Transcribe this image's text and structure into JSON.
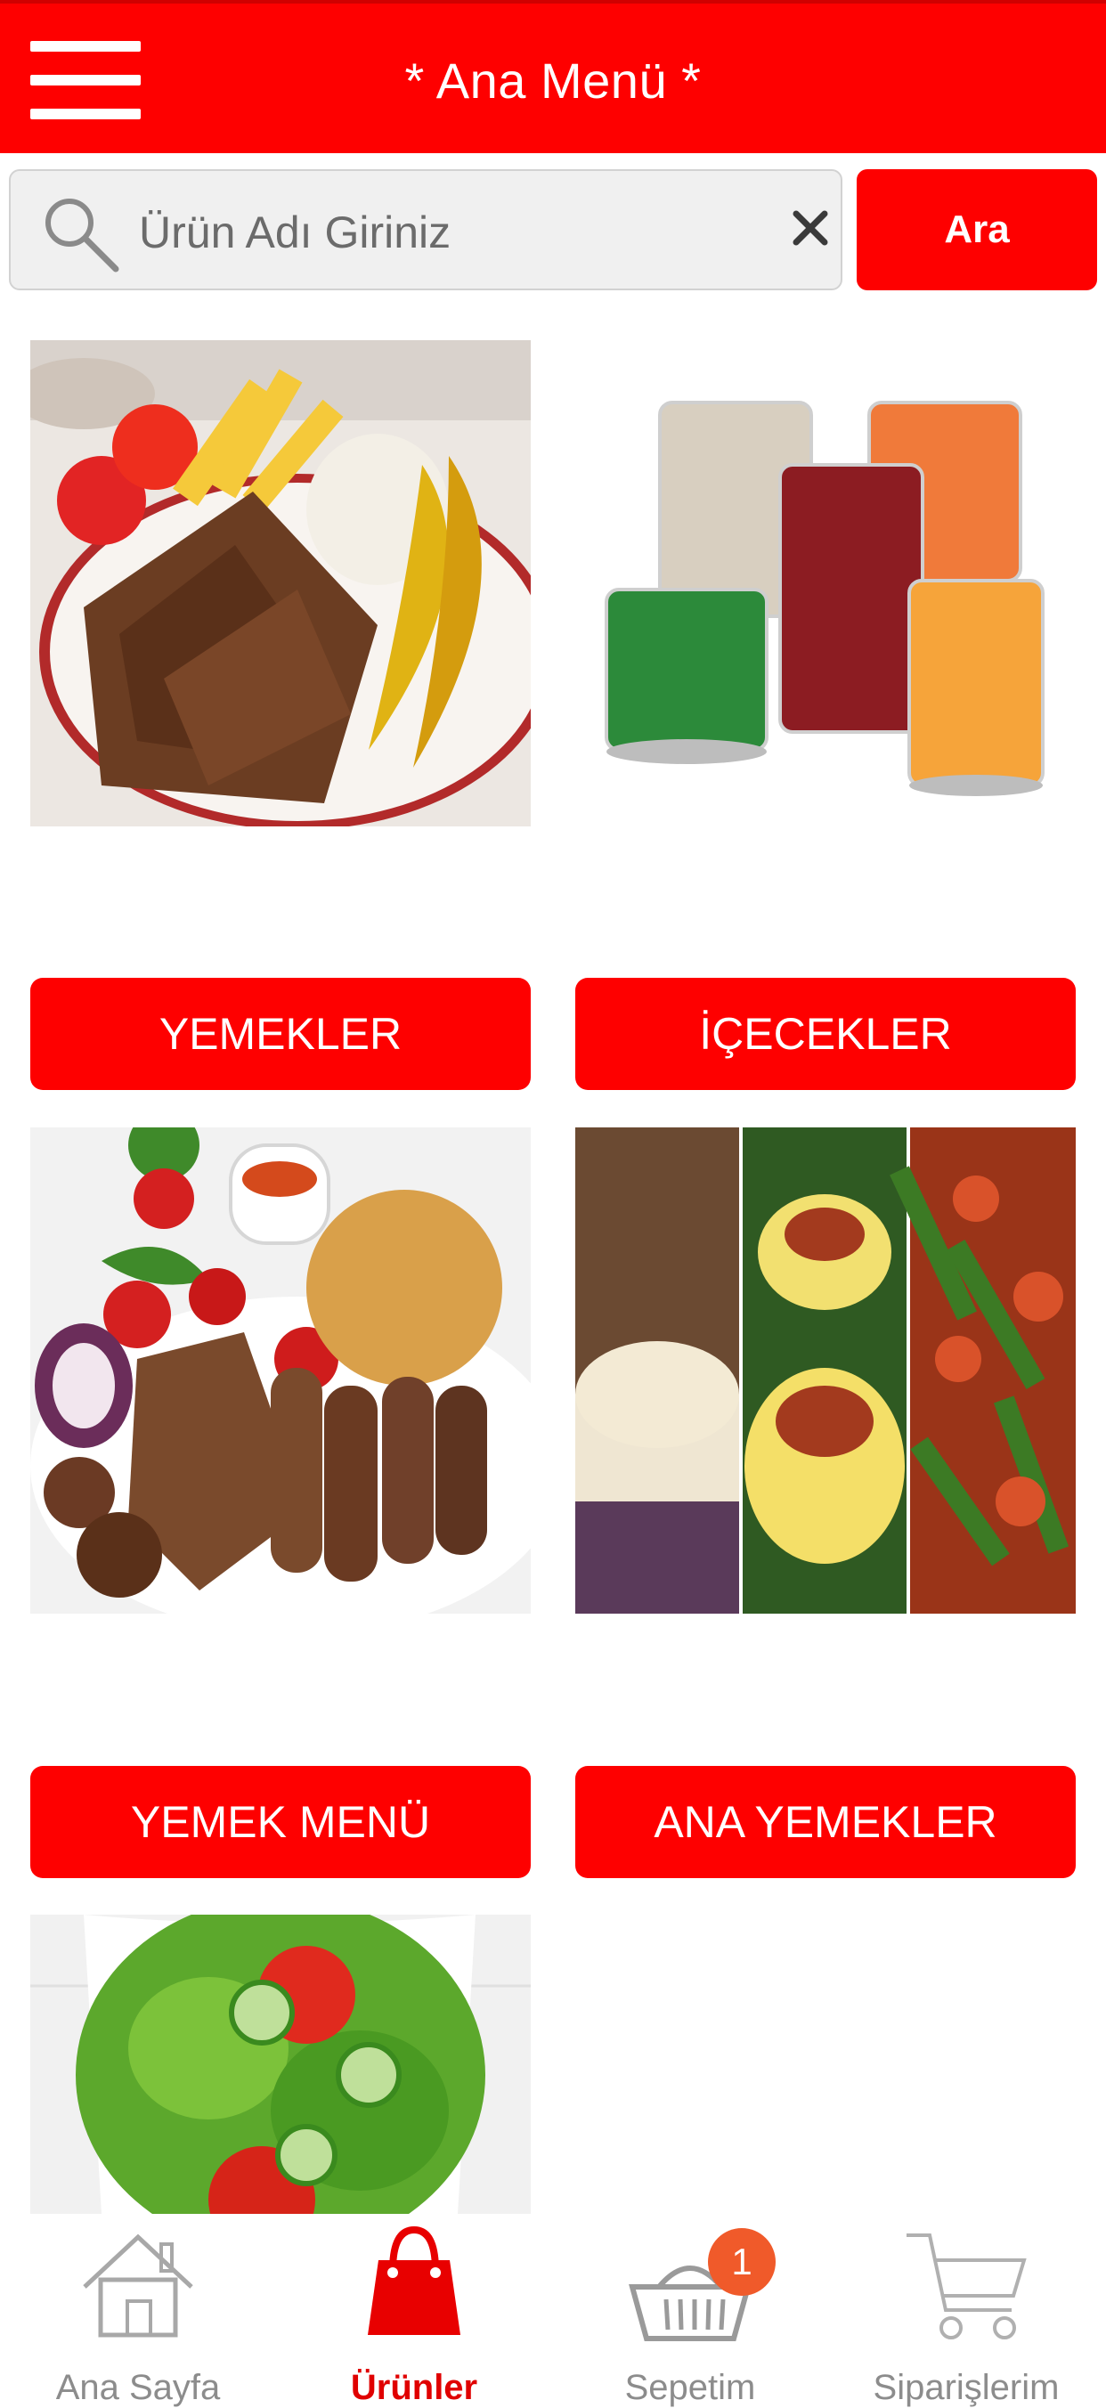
{
  "header": {
    "title": "* Ana Menü *",
    "menu_icon": "hamburger-menu-icon"
  },
  "search": {
    "placeholder": "Ürün Adı Giriniz",
    "value": "",
    "button_label": "Ara",
    "search_icon": "search-icon",
    "clear_icon": "close-icon"
  },
  "categories": [
    {
      "label": "YEMEKLER",
      "image": "doner-plate-image"
    },
    {
      "label": "İÇECEKLER",
      "image": "juice-glasses-image"
    },
    {
      "label": "YEMEK MENÜ",
      "image": "kebab-plate-image"
    },
    {
      "label": "ANA YEMEKLER",
      "image": "main-dishes-collage-image"
    },
    {
      "label": "",
      "image": "salad-bowl-image"
    }
  ],
  "tabbar": {
    "items": [
      {
        "label": "Ana Sayfa",
        "icon": "home-icon",
        "active": false
      },
      {
        "label": "Ürünler",
        "icon": "shopping-bag-icon",
        "active": true
      },
      {
        "label": "Sepetim",
        "icon": "basket-icon",
        "active": false,
        "badge": "1"
      },
      {
        "label": "Siparişlerim",
        "icon": "cart-icon",
        "active": false
      }
    ]
  },
  "colors": {
    "brand_red": "#fe0000",
    "badge_orange": "#f05a2a",
    "inactive_gray": "#8c8c8c"
  }
}
